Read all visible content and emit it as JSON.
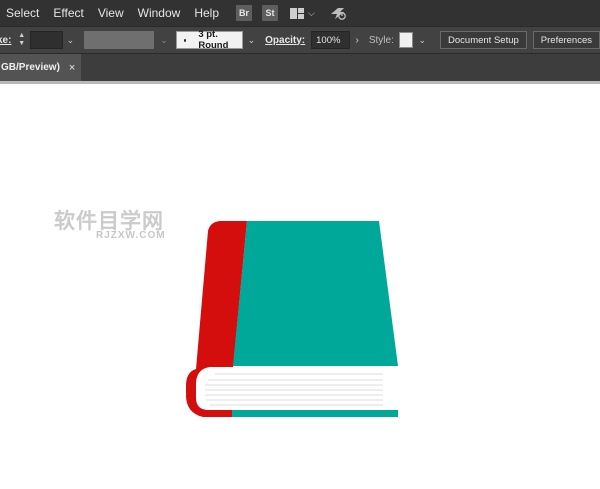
{
  "menubar": {
    "items": [
      "Select",
      "Effect",
      "View",
      "Window",
      "Help"
    ],
    "badges": [
      "Br",
      "St"
    ]
  },
  "controlbar": {
    "stroke_label": "ke:",
    "brush": "3 pt. Round",
    "opacity_label": "Opacity:",
    "opacity_value": "100%",
    "style_label": "Style:",
    "document_setup": "Document Setup",
    "preferences": "Preferences"
  },
  "tab": {
    "title": "GB/Preview)",
    "close": "×"
  },
  "watermark": {
    "cn": "软件目学网",
    "en": "RJZXW.COM"
  },
  "colors": {
    "menubar_bg": "#323232",
    "controlbar_bg": "#424242",
    "book_cover": "#00a89a",
    "book_spine": "#d40d0d",
    "pages": "#ffffff"
  },
  "icons": [
    "workspace-switcher-icon",
    "chevron-down-icon",
    "gpu-sync-icon",
    "stepper-icon",
    "close-icon"
  ]
}
